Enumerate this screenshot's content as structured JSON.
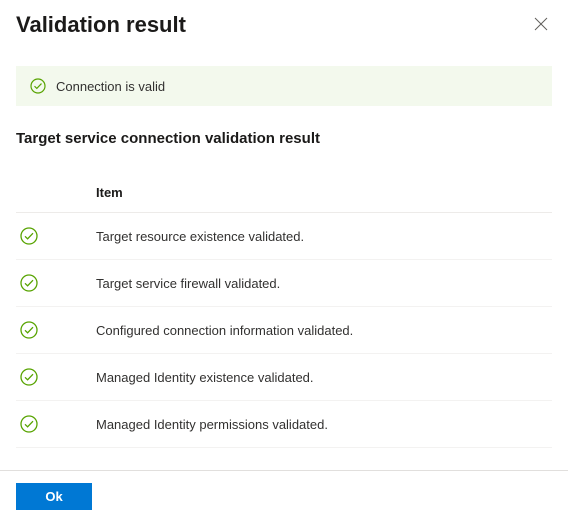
{
  "header": {
    "title": "Validation result"
  },
  "banner": {
    "message": "Connection is valid"
  },
  "section": {
    "subtitle": "Target service connection validation result"
  },
  "table": {
    "column_header": "Item",
    "rows": [
      {
        "text": "Target resource existence validated."
      },
      {
        "text": "Target service firewall validated."
      },
      {
        "text": "Configured connection information validated."
      },
      {
        "text": "Managed Identity existence validated."
      },
      {
        "text": "Managed Identity permissions validated."
      }
    ]
  },
  "footer": {
    "ok_label": "Ok"
  }
}
